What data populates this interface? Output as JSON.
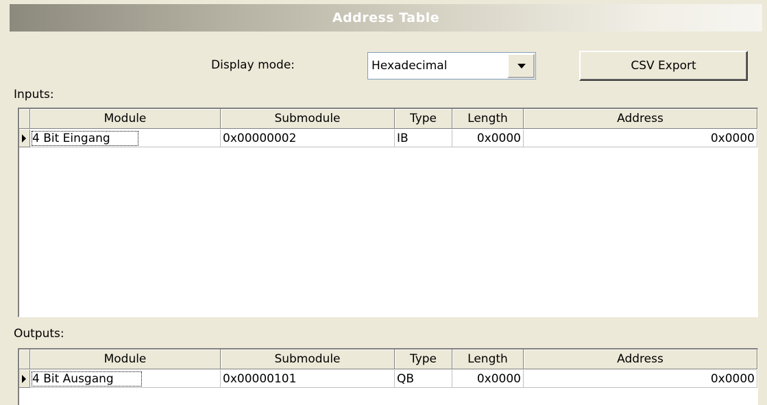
{
  "window": {
    "title": "Address Table"
  },
  "toolbar": {
    "display_mode_label": "Display mode:",
    "display_mode_value": "Hexadecimal",
    "csv_export_label": "CSV Export"
  },
  "inputs": {
    "label": "Inputs:",
    "columns": [
      "Module",
      "Submodule",
      "Type",
      "Length",
      "Address"
    ],
    "rows": [
      {
        "module": "4 Bit Eingang",
        "submodule": "0x00000002",
        "type": "IB",
        "length": "0x0000",
        "address": "0x0000"
      }
    ]
  },
  "outputs": {
    "label": "Outputs:",
    "columns": [
      "Module",
      "Submodule",
      "Type",
      "Length",
      "Address"
    ],
    "rows": [
      {
        "module": "4 Bit Ausgang",
        "submodule": "0x00000101",
        "type": "QB",
        "length": "0x0000",
        "address": "0x0000"
      }
    ]
  },
  "colors": {
    "background": "#ece9d8",
    "banner_dark": "#8c8a7d",
    "banner_light": "#f6f5f0",
    "grid_background": "#ffffff"
  },
  "icons": {
    "combo_arrow": "chevron-down-icon",
    "row_indicator": "row-pointer-icon"
  }
}
